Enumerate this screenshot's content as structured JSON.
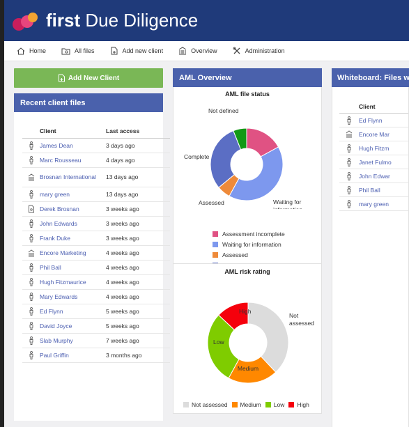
{
  "app": {
    "brand_bold": "first",
    "brand_rest": " Due Diligence"
  },
  "nav": [
    {
      "label": "Home",
      "icon": "home-icon"
    },
    {
      "label": "All files",
      "icon": "folder-search-icon"
    },
    {
      "label": "Add new client",
      "icon": "add-file-icon"
    },
    {
      "label": "Overview",
      "icon": "building-icon"
    },
    {
      "label": "Administration",
      "icon": "tools-icon"
    }
  ],
  "add_button": {
    "label": "Add New Client"
  },
  "recent": {
    "title": "Recent client files",
    "col_client": "Client",
    "col_access": "Last access",
    "rows": [
      {
        "name": "James Dean",
        "date": "3 days ago",
        "icon": "person-icon"
      },
      {
        "name": "Marc Rousseau",
        "date": "4 days ago",
        "icon": "person-icon"
      },
      {
        "name": "Brosnan International",
        "date": "13 days ago",
        "icon": "building-icon"
      },
      {
        "name": "mary green",
        "date": "13 days ago",
        "icon": "person-icon"
      },
      {
        "name": "Derek Brosnan",
        "date": "3 weeks ago",
        "icon": "document-icon"
      },
      {
        "name": "John Edwards",
        "date": "3 weeks ago",
        "icon": "person-icon"
      },
      {
        "name": "Frank Duke",
        "date": "3 weeks ago",
        "icon": "person-icon"
      },
      {
        "name": "Encore Marketing",
        "date": "4 weeks ago",
        "icon": "building-icon"
      },
      {
        "name": "Phil Ball",
        "date": "4 weeks ago",
        "icon": "person-icon"
      },
      {
        "name": "Hugh Fitzmaurice",
        "date": "4 weeks ago",
        "icon": "person-icon"
      },
      {
        "name": "Mary Edwards",
        "date": "4 weeks ago",
        "icon": "person-icon"
      },
      {
        "name": "Ed Flynn",
        "date": "5 weeks ago",
        "icon": "person-icon"
      },
      {
        "name": "David Joyce",
        "date": "5 weeks ago",
        "icon": "person-icon"
      },
      {
        "name": "Slab Murphy",
        "date": "7 weeks ago",
        "icon": "person-icon"
      },
      {
        "name": "Paul Griffin",
        "date": "3 months ago",
        "icon": "person-icon"
      }
    ]
  },
  "aml_overview": {
    "title": "AML Overview"
  },
  "whiteboard": {
    "title": "Whiteboard: Files w",
    "col_client": "Client",
    "rows": [
      {
        "name": "Ed Flynn",
        "icon": "person-icon"
      },
      {
        "name": "Encore Mar",
        "icon": "building-icon"
      },
      {
        "name": "Hugh Fitzm",
        "icon": "person-icon"
      },
      {
        "name": "Janet Fulmo",
        "icon": "person-icon"
      },
      {
        "name": "John Edwar",
        "icon": "person-icon"
      },
      {
        "name": "Phil Ball",
        "icon": "person-icon"
      },
      {
        "name": "mary green",
        "icon": "person-icon"
      }
    ]
  },
  "colors": {
    "header": "#1f3a7a",
    "panel_head": "#4a61ac",
    "add_button": "#7ab756",
    "link": "#4a5db0"
  },
  "chart_data": [
    {
      "type": "pie",
      "title": "AML file status",
      "categories": [
        "Assessment incomplete",
        "Waiting for information",
        "Assessed",
        "Complete",
        "Not defined"
      ],
      "slice_labels": [
        "",
        "Waiting for information",
        "Assessed",
        "Complete",
        "Not defined"
      ],
      "values": [
        17,
        41,
        6,
        30,
        6
      ],
      "colors": [
        "#e05283",
        "#7d98ee",
        "#ee8a3a",
        "#5b6ec4",
        "#129915"
      ],
      "legend": [
        "Assessment incomplete",
        "Waiting for information",
        "Assessed",
        "Complete"
      ],
      "legend_placement": "bottom"
    },
    {
      "type": "pie",
      "title": "AML risk rating",
      "categories": [
        "Not assessed",
        "Medium",
        "Low",
        "High"
      ],
      "slice_labels": [
        "Not assessed",
        "Medium",
        "Low",
        "High"
      ],
      "values": [
        38,
        20,
        29,
        13
      ],
      "colors": [
        "#dcdcdc",
        "#ff8800",
        "#7fcc00",
        "#f5000c"
      ],
      "legend": [
        "Not assessed",
        "Medium",
        "Low",
        "High"
      ],
      "legend_placement": "bottom"
    }
  ]
}
